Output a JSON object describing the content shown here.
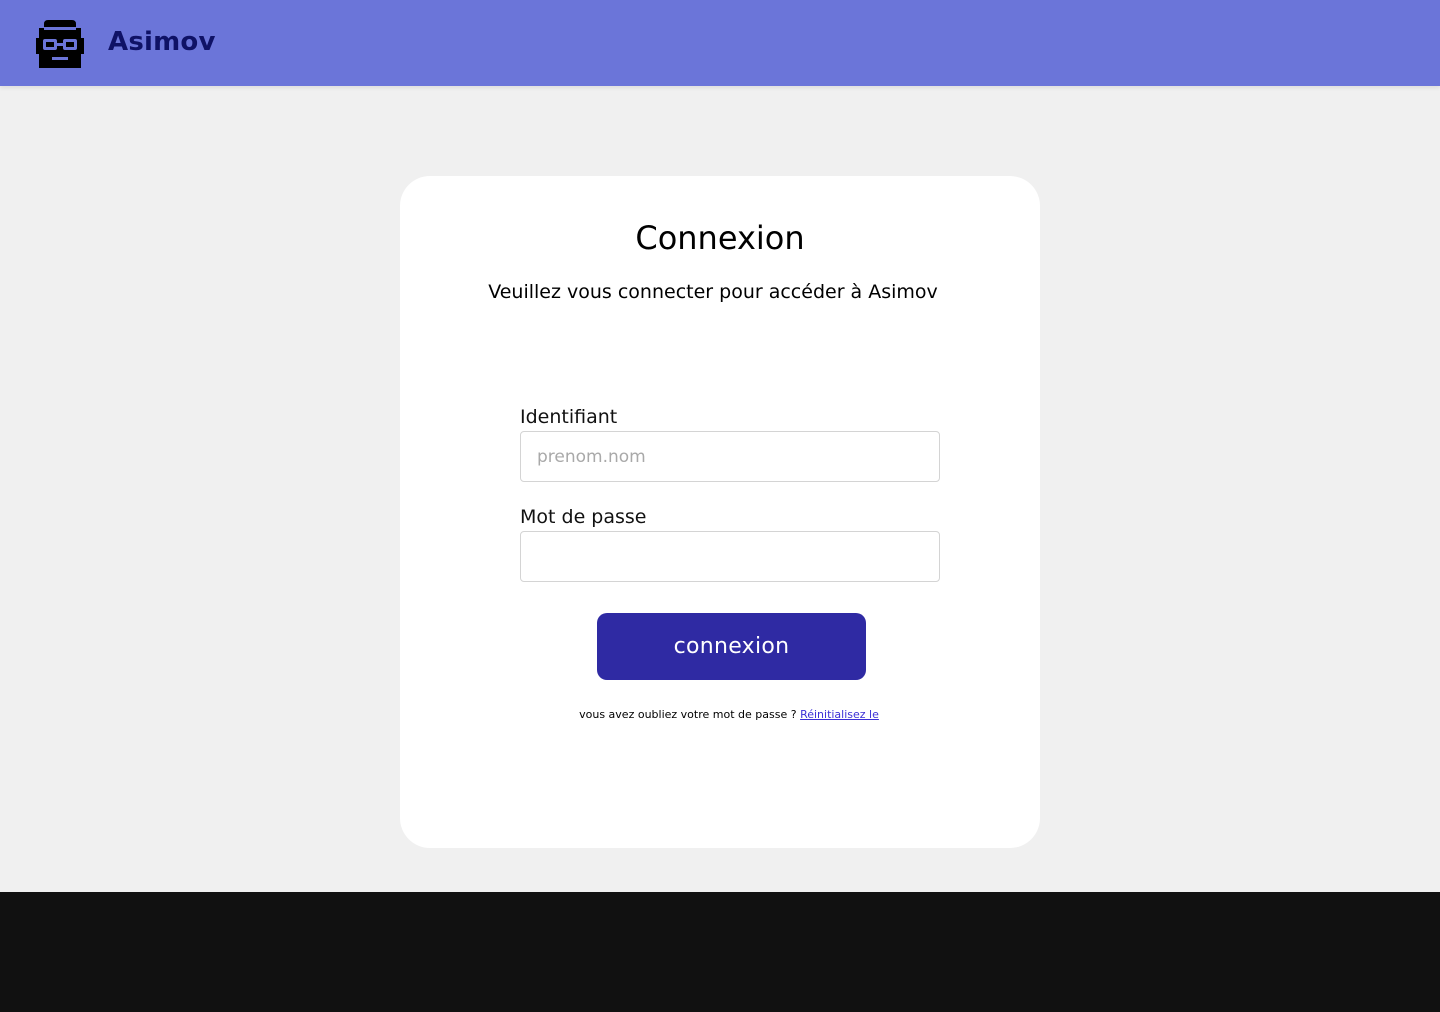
{
  "header": {
    "brand": "Asimov",
    "logo_icon": "robot-glasses-icon",
    "background_color": "#6b75d9",
    "brand_color": "#0f1266"
  },
  "login": {
    "title": "Connexion",
    "subtitle": "Veuillez vous connecter pour accéder à Asimov",
    "username_label": "Identifiant",
    "username_placeholder": "prenom.nom",
    "username_value": "",
    "password_label": "Mot de passe",
    "password_value": "",
    "submit_label": "connexion",
    "submit_color": "#2f2aa3",
    "forgot_text": "vous avez oubliez votre mot de passe ? ",
    "reset_link": "Réinitialisez le",
    "reset_link_color": "#3b2fd6"
  },
  "footer": {
    "background_color": "#111111"
  }
}
